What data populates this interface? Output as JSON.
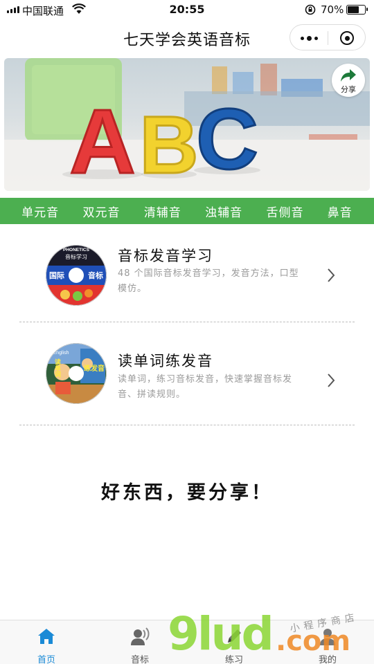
{
  "status_bar": {
    "carrier": "中国联通",
    "time": "20:55",
    "battery_percent": "70%",
    "battery_level": 0.7
  },
  "nav": {
    "title": "七天学会英语音标",
    "more_icon": "more-dots-icon",
    "close_icon": "target-close-icon"
  },
  "banner": {
    "letters": [
      "A",
      "B",
      "C"
    ],
    "letter_colors": [
      "#e63a3a",
      "#f2d22e",
      "#1e5fb3"
    ],
    "share_label": "分享"
  },
  "tabs": [
    "单元音",
    "双元音",
    "清辅音",
    "浊辅音",
    "舌侧音",
    "鼻音"
  ],
  "accent_color": "#4caf50",
  "list": [
    {
      "title": "音标发音学习",
      "desc": "48 个国际音标发音学习，发音方法，口型模仿。",
      "disc_top_text": "PHONETICS",
      "disc_sub_text": "音标学习",
      "disc_left": "国际",
      "disc_right": "音标"
    },
    {
      "title": "读单词练发音",
      "desc": "读单词，练习音标发音，快速掌握音标发音、拼读规则。",
      "disc_left_top": "English",
      "disc_left_main": "读单词",
      "disc_right_main": "练发音"
    }
  ],
  "slogan": "好东西，要分享！",
  "tabbar": [
    {
      "label": "首页",
      "icon": "home-icon",
      "active": true
    },
    {
      "label": "音标",
      "icon": "speaker-person-icon",
      "active": false
    },
    {
      "label": "练习",
      "icon": "pencil-icon",
      "active": false
    },
    {
      "label": "我的",
      "icon": "user-icon",
      "active": false
    }
  ],
  "watermark": {
    "brand": "9lud",
    "domain": ".com",
    "tagline": "小程序商店"
  }
}
